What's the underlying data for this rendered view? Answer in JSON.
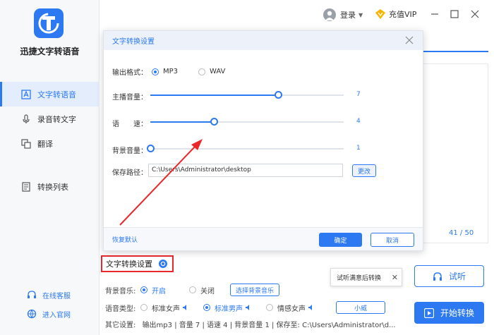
{
  "app": {
    "title": "迅捷文字转语音"
  },
  "sidebar": {
    "items": [
      {
        "label": "文字转语音",
        "icon": "text-to-speech-icon",
        "active": true
      },
      {
        "label": "录音转文字",
        "icon": "microphone-icon",
        "active": false
      },
      {
        "label": "翻译",
        "icon": "translate-icon",
        "active": false
      },
      {
        "label": "转换列表",
        "icon": "convert-list-icon",
        "active": false
      }
    ],
    "bottom": [
      {
        "label": "在线客服",
        "icon": "headset-icon"
      },
      {
        "label": "进入官网",
        "icon": "globe-icon"
      }
    ]
  },
  "titlebar": {
    "login": "登录",
    "vip": "充值VIP"
  },
  "main": {
    "counter": "41 / 50"
  },
  "modal": {
    "title": "文字转换设置",
    "format_label": "输出格式：",
    "format_options": [
      "MP3",
      "WAV"
    ],
    "format_selected": "MP3",
    "sliders": [
      {
        "label": "主播音量：",
        "value": "7",
        "fraction": 0.66
      },
      {
        "label": "语　　速：",
        "value": "4",
        "fraction": 0.33
      },
      {
        "label": "背景音量：",
        "value": "1",
        "fraction": 0.0
      }
    ],
    "path_label": "保存路径：",
    "path_value": "C:\\Users\\Administrator\\desktop",
    "change_button": "更改",
    "restore": "恢复默认",
    "ok": "确定",
    "cancel": "取消"
  },
  "settings": {
    "header": "文字转换设置",
    "bg_music_label": "背景音乐:",
    "bg_on": "开启",
    "bg_off": "关闭",
    "bg_select": "选择背景音乐",
    "voice_label": "语音类型:",
    "voices": [
      "标准女声",
      "标准男声",
      "情感女声"
    ],
    "voice_selected": "标准男声",
    "voice_extra": "小威",
    "other_label": "其它设置:",
    "other_summary": "输出mp3 | 音量 7 | 语速 4 | 背景音量 1 | 保存至: C:\\Users\\Administrator\\d..."
  },
  "tooltip": {
    "text": "试听满意后转换"
  },
  "buttons": {
    "listen": "试听",
    "start": "开始转换"
  },
  "colors": {
    "accent": "#2c79f1",
    "highlight": "#e8282b"
  }
}
